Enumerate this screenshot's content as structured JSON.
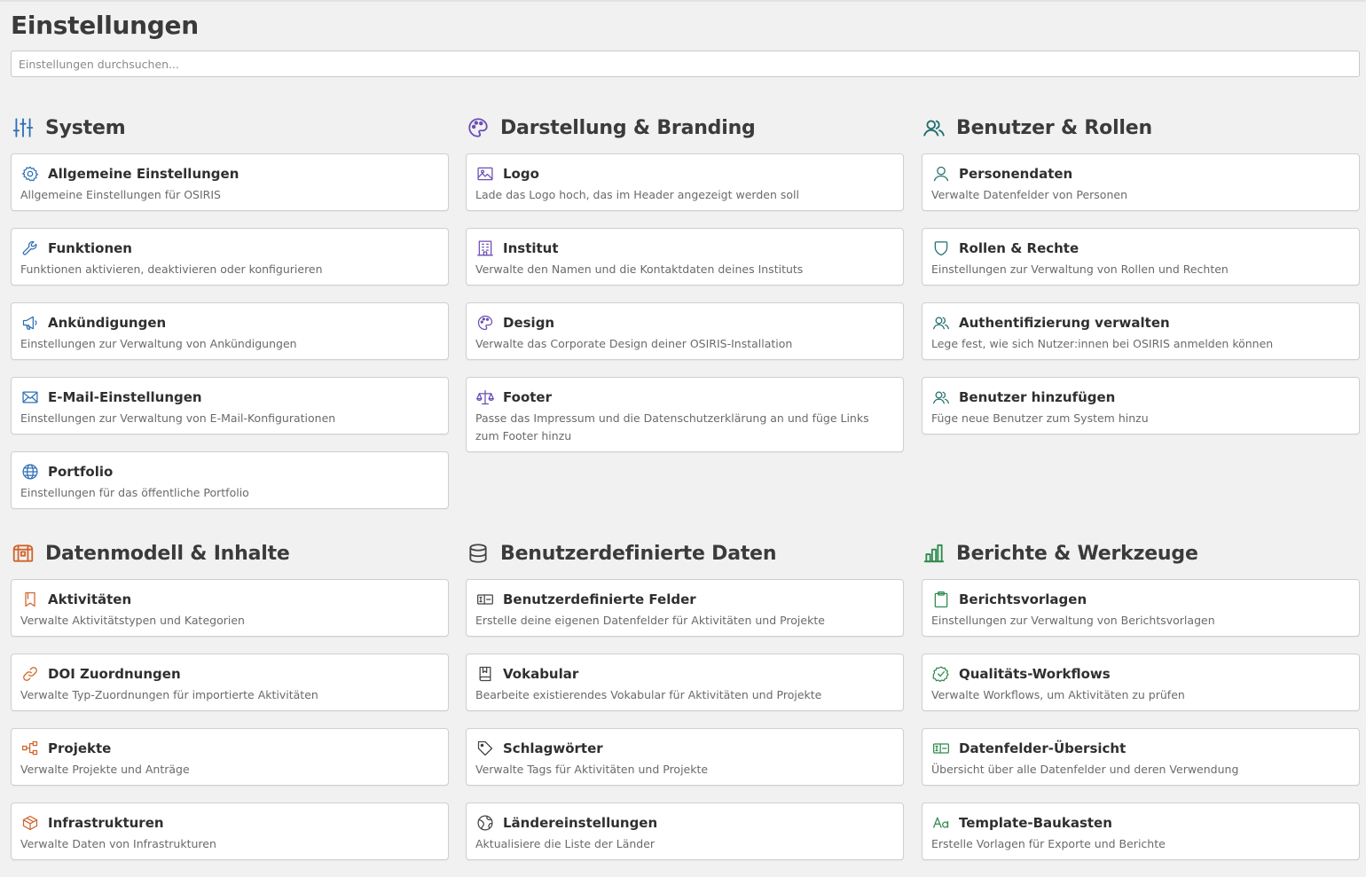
{
  "page": {
    "title": "Einstellungen",
    "search_placeholder": "Einstellungen durchsuchen..."
  },
  "colors": {
    "system": "#2f6fb5",
    "branding": "#6b4db3",
    "users": "#1f6e6e",
    "datamodel": "#d0652a",
    "custom": "#444444",
    "reports": "#2d8a4e"
  },
  "sections": [
    {
      "title": "System",
      "icon": "sliders-icon",
      "cards": [
        {
          "title": "Allgemeine Einstellungen",
          "desc": "Allgemeine Einstellungen für OSIRIS",
          "icon": "gear-icon"
        },
        {
          "title": "Funktionen",
          "desc": "Funktionen aktivieren, deaktivieren oder konfigurieren",
          "icon": "wrench-icon"
        },
        {
          "title": "Ankündigungen",
          "desc": "Einstellungen zur Verwaltung von Ankündigungen",
          "icon": "megaphone-icon"
        },
        {
          "title": "E-Mail-Einstellungen",
          "desc": "Einstellungen zur Verwaltung von E-Mail-Konfigurationen",
          "icon": "envelope-icon"
        },
        {
          "title": "Portfolio",
          "desc": "Einstellungen für das öffentliche Portfolio",
          "icon": "globe-icon"
        }
      ]
    },
    {
      "title": "Darstellung & Branding",
      "icon": "palette-icon",
      "cards": [
        {
          "title": "Logo",
          "desc": "Lade das Logo hoch, das im Header angezeigt werden soll",
          "icon": "image-icon"
        },
        {
          "title": "Institut",
          "desc": "Verwalte den Namen und die Kontaktdaten deines Instituts",
          "icon": "building-icon"
        },
        {
          "title": "Design",
          "desc": "Verwalte das Corporate Design deiner OSIRIS-Installation",
          "icon": "palette-icon"
        },
        {
          "title": "Footer",
          "desc": "Passe das Impressum und die Datenschutzerklärung an und füge Links zum Footer hinzu",
          "icon": "scales-icon"
        }
      ]
    },
    {
      "title": "Benutzer & Rollen",
      "icon": "users-icon",
      "cards": [
        {
          "title": "Personendaten",
          "desc": "Verwalte Datenfelder von Personen",
          "icon": "user-icon"
        },
        {
          "title": "Rollen & Rechte",
          "desc": "Einstellungen zur Verwaltung von Rollen und Rechten",
          "icon": "shield-icon"
        },
        {
          "title": "Authentifizierung verwalten",
          "desc": "Lege fest, wie sich Nutzer:innen bei OSIRIS anmelden können",
          "icon": "users-icon"
        },
        {
          "title": "Benutzer hinzufügen",
          "desc": "Füge neue Benutzer zum System hinzu",
          "icon": "users-icon"
        }
      ]
    },
    {
      "title": "Datenmodell & Inhalte",
      "icon": "treasure-chest-icon",
      "cards": [
        {
          "title": "Aktivitäten",
          "desc": "Verwalte Aktivitätstypen und Kategorien",
          "icon": "bookmark-icon"
        },
        {
          "title": "DOI Zuordnungen",
          "desc": "Verwalte Typ-Zuordnungen für importierte Aktivitäten",
          "icon": "link-icon"
        },
        {
          "title": "Projekte",
          "desc": "Verwalte Projekte und Anträge",
          "icon": "tree-structure-icon"
        },
        {
          "title": "Infrastrukturen",
          "desc": "Verwalte Daten von Infrastrukturen",
          "icon": "cube-icon"
        }
      ]
    },
    {
      "title": "Benutzerdefinierte Daten",
      "icon": "database-icon",
      "cards": [
        {
          "title": "Benutzerdefinierte Felder",
          "desc": "Erstelle deine eigenen Datenfelder für Aktivitäten und Projekte",
          "icon": "textbox-icon"
        },
        {
          "title": "Vokabular",
          "desc": "Bearbeite existierendes Vokabular für Aktivitäten und Projekte",
          "icon": "book-icon"
        },
        {
          "title": "Schlagwörter",
          "desc": "Verwalte Tags für Aktivitäten und Projekte",
          "icon": "tag-icon"
        },
        {
          "title": "Ländereinstellungen",
          "desc": "Aktualisiere die Liste der Länder",
          "icon": "globe-hemisphere-icon"
        }
      ]
    },
    {
      "title": "Berichte & Werkzeuge",
      "icon": "chart-bar-icon",
      "cards": [
        {
          "title": "Berichtsvorlagen",
          "desc": "Einstellungen zur Verwaltung von Berichtsvorlagen",
          "icon": "clipboard-icon"
        },
        {
          "title": "Qualitäts-Workflows",
          "desc": "Verwalte Workflows, um Aktivitäten zu prüfen",
          "icon": "seal-check-icon"
        },
        {
          "title": "Datenfelder-Übersicht",
          "desc": "Übersicht über alle Datenfelder und deren Verwendung",
          "icon": "textbox-icon"
        },
        {
          "title": "Template-Baukasten",
          "desc": "Erstelle Vorlagen für Exporte und Berichte",
          "icon": "text-aa-icon"
        }
      ]
    }
  ]
}
